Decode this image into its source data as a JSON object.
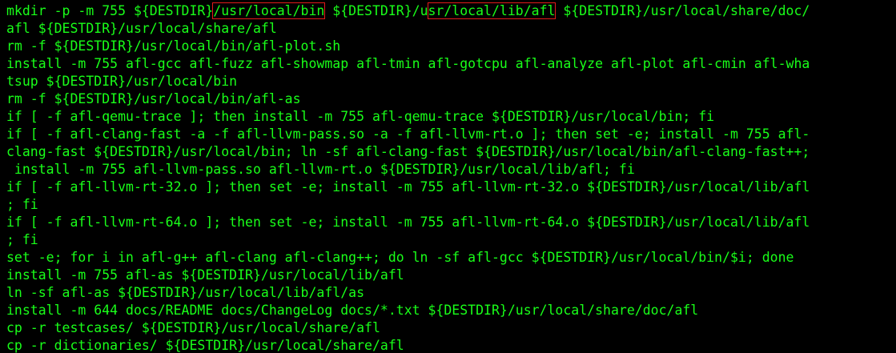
{
  "colors": {
    "background": "#000000",
    "text": "#19ff19",
    "highlight_box": "#e21b1b"
  },
  "terminal": {
    "line0": {
      "a": "mkdir -p -m 755 ${DESTDIR}",
      "b": "/usr/local/bin",
      "c": " ${DESTDIR}/u",
      "d": "sr/local/lib/afl",
      "e": " ${DESTDIR}/usr/local/share/doc/"
    },
    "lines": [
      "afl ${DESTDIR}/usr/local/share/afl",
      "rm -f ${DESTDIR}/usr/local/bin/afl-plot.sh",
      "install -m 755 afl-gcc afl-fuzz afl-showmap afl-tmin afl-gotcpu afl-analyze afl-plot afl-cmin afl-wha",
      "tsup ${DESTDIR}/usr/local/bin",
      "rm -f ${DESTDIR}/usr/local/bin/afl-as",
      "if [ -f afl-qemu-trace ]; then install -m 755 afl-qemu-trace ${DESTDIR}/usr/local/bin; fi",
      "if [ -f afl-clang-fast -a -f afl-llvm-pass.so -a -f afl-llvm-rt.o ]; then set -e; install -m 755 afl-",
      "clang-fast ${DESTDIR}/usr/local/bin; ln -sf afl-clang-fast ${DESTDIR}/usr/local/bin/afl-clang-fast++;",
      " install -m 755 afl-llvm-pass.so afl-llvm-rt.o ${DESTDIR}/usr/local/lib/afl; fi",
      "if [ -f afl-llvm-rt-32.o ]; then set -e; install -m 755 afl-llvm-rt-32.o ${DESTDIR}/usr/local/lib/afl",
      "; fi",
      "if [ -f afl-llvm-rt-64.o ]; then set -e; install -m 755 afl-llvm-rt-64.o ${DESTDIR}/usr/local/lib/afl",
      "; fi",
      "set -e; for i in afl-g++ afl-clang afl-clang++; do ln -sf afl-gcc ${DESTDIR}/usr/local/bin/$i; done",
      "install -m 755 afl-as ${DESTDIR}/usr/local/lib/afl",
      "ln -sf afl-as ${DESTDIR}/usr/local/lib/afl/as",
      "install -m 644 docs/README docs/ChangeLog docs/*.txt ${DESTDIR}/usr/local/share/doc/afl",
      "cp -r testcases/ ${DESTDIR}/usr/local/share/afl",
      "cp -r dictionaries/ ${DESTDIR}/usr/local/share/afl"
    ]
  }
}
